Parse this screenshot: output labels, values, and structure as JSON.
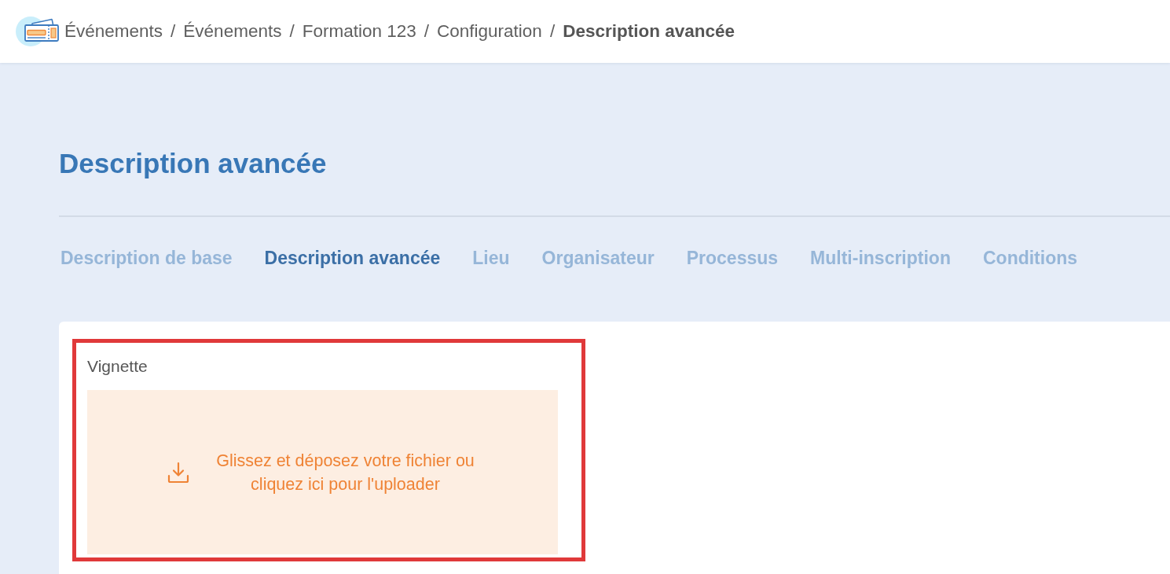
{
  "breadcrumb": {
    "separator": "/",
    "items": [
      {
        "label": "Événements",
        "current": false
      },
      {
        "label": "Événements",
        "current": false
      },
      {
        "label": "Formation 123",
        "current": false
      },
      {
        "label": "Configuration",
        "current": false
      },
      {
        "label": "Description avancée",
        "current": true
      }
    ]
  },
  "page_title": "Description avancée",
  "tabs": [
    {
      "label": "Description de base",
      "selected": false
    },
    {
      "label": "Description avancée",
      "selected": true
    },
    {
      "label": "Lieu",
      "selected": false
    },
    {
      "label": "Organisateur",
      "selected": false
    },
    {
      "label": "Processus",
      "selected": false
    },
    {
      "label": "Multi-inscription",
      "selected": false
    },
    {
      "label": "Conditions",
      "selected": false
    }
  ],
  "upload_section": {
    "label": "Vignette",
    "highlighted": true,
    "dropzone": {
      "text_lines": [
        "Glissez et déposez votre fichier ou",
        "cliquez ici pour l'uploader"
      ]
    }
  }
}
